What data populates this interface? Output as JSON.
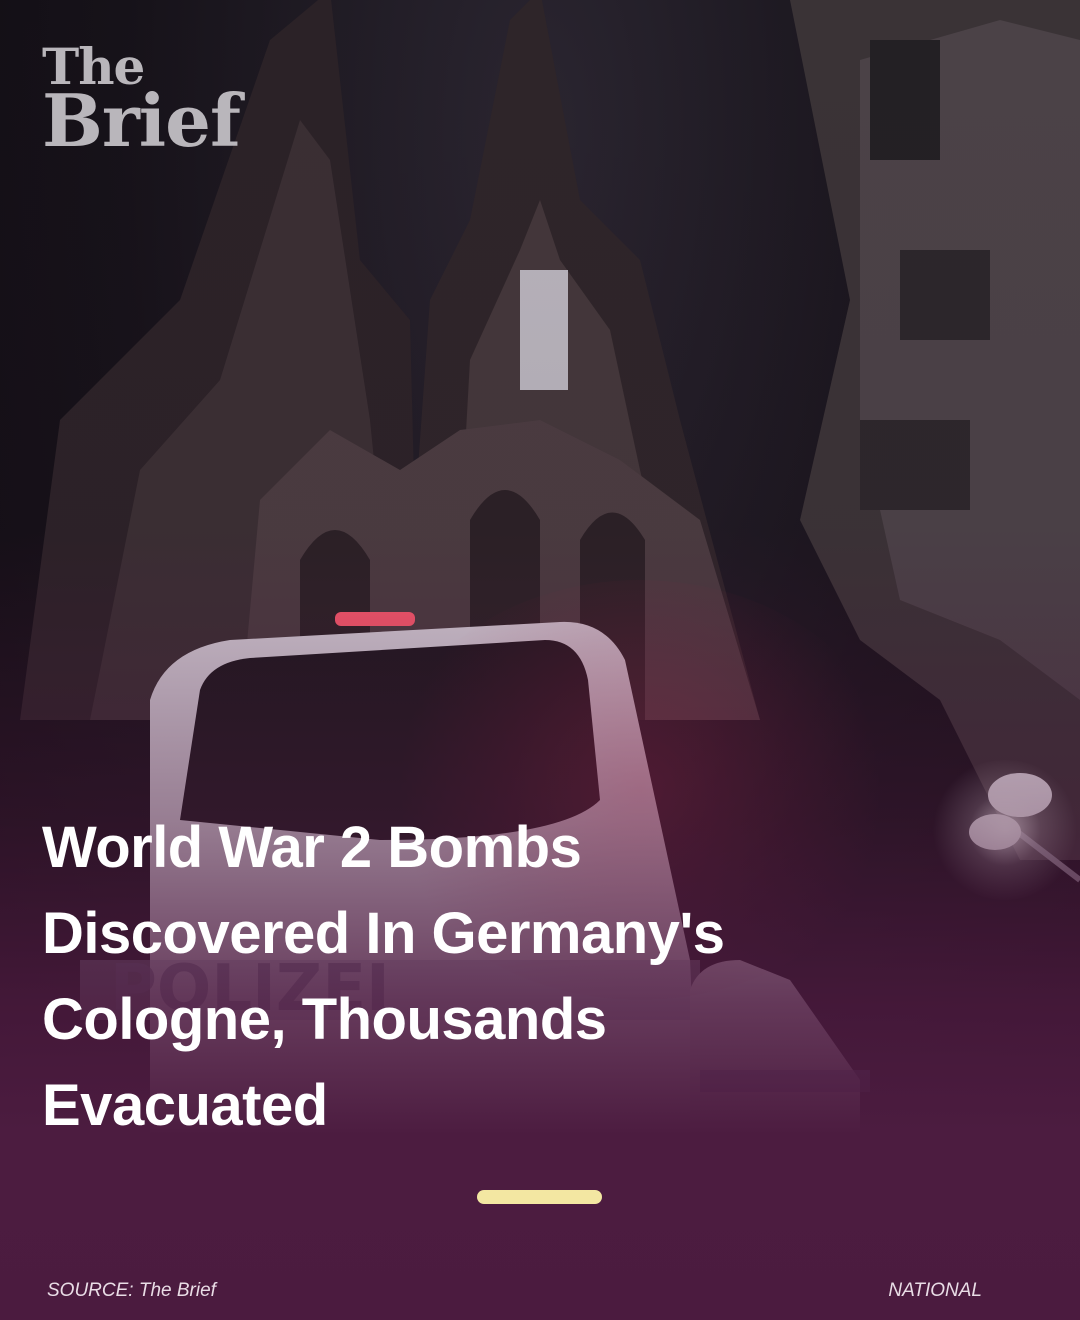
{
  "brand": {
    "line1": "The",
    "line2": "Brief"
  },
  "headline": "World War 2 Bombs Discovered In Germany's Cologne, Thousands Evacuated",
  "footer": {
    "source": "SOURCE: The Brief",
    "category": "NATIONAL"
  },
  "colors": {
    "accent": "#f3e7a2",
    "overlay": "#4b1b3f",
    "logo": "#b9b6bb"
  },
  "background_image": {
    "subject": "cathedral-night-police-van",
    "van_text": "POLIZEI"
  }
}
